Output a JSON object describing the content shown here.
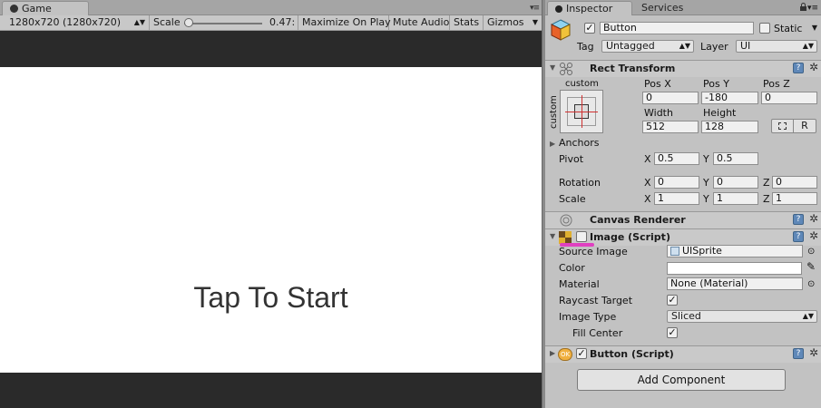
{
  "game": {
    "tab_label": "Game",
    "resolution": "1280x720 (1280x720)",
    "scale_label": "Scale",
    "scale_value": "0.47:",
    "scale_fraction": 0.04,
    "maximize_label": "Maximize On Play",
    "mute_label": "Mute Audio",
    "stats_label": "Stats",
    "gizmos_label": "Gizmos",
    "canvas_text": "Tap To Start"
  },
  "inspector": {
    "tab_label": "Inspector",
    "services_label": "Services",
    "object_name": "Button",
    "active": true,
    "static_label": "Static",
    "static_checked": false,
    "tag_label": "Tag",
    "tag_value": "Untagged",
    "layer_label": "Layer",
    "layer_value": "UI",
    "rect_transform": {
      "title": "Rect Transform",
      "anchor_preset": "custom",
      "anchor_side": "custom",
      "pos_x_label": "Pos X",
      "pos_y_label": "Pos Y",
      "pos_z_label": "Pos Z",
      "pos_x": "0",
      "pos_y": "-180",
      "pos_z": "0",
      "width_label": "Width",
      "height_label": "Height",
      "width": "512",
      "height": "128",
      "raw_label": "R",
      "anchors_label": "Anchors",
      "pivot_label": "Pivot",
      "pivot_x": "0.5",
      "pivot_y": "0.5",
      "rotation_label": "Rotation",
      "rot_x": "0",
      "rot_y": "0",
      "rot_z": "0",
      "scale_label": "Scale",
      "scale_x": "1",
      "scale_y": "1",
      "scale_z": "1",
      "axis_x": "X",
      "axis_y": "Y",
      "axis_z": "Z"
    },
    "canvas_renderer": {
      "title": "Canvas Renderer"
    },
    "image": {
      "title": "Image (Script)",
      "source_image_label": "Source Image",
      "source_image": "UISprite",
      "color_label": "Color",
      "material_label": "Material",
      "material": "None (Material)",
      "raycast_label": "Raycast Target",
      "raycast_checked": true,
      "image_type_label": "Image Type",
      "image_type": "Sliced",
      "fill_center_label": "Fill Center",
      "fill_center_checked": true
    },
    "button_component": {
      "title": "Button (Script)",
      "icon_text": "OK"
    },
    "add_component_label": "Add Component"
  },
  "colors": {
    "editor_bg": "#c2c2c2",
    "game_bg": "#2a2a2a",
    "canvas_bg": "#ffffff",
    "highlight": "#e040c0",
    "help_blue": "#5f88b8"
  }
}
